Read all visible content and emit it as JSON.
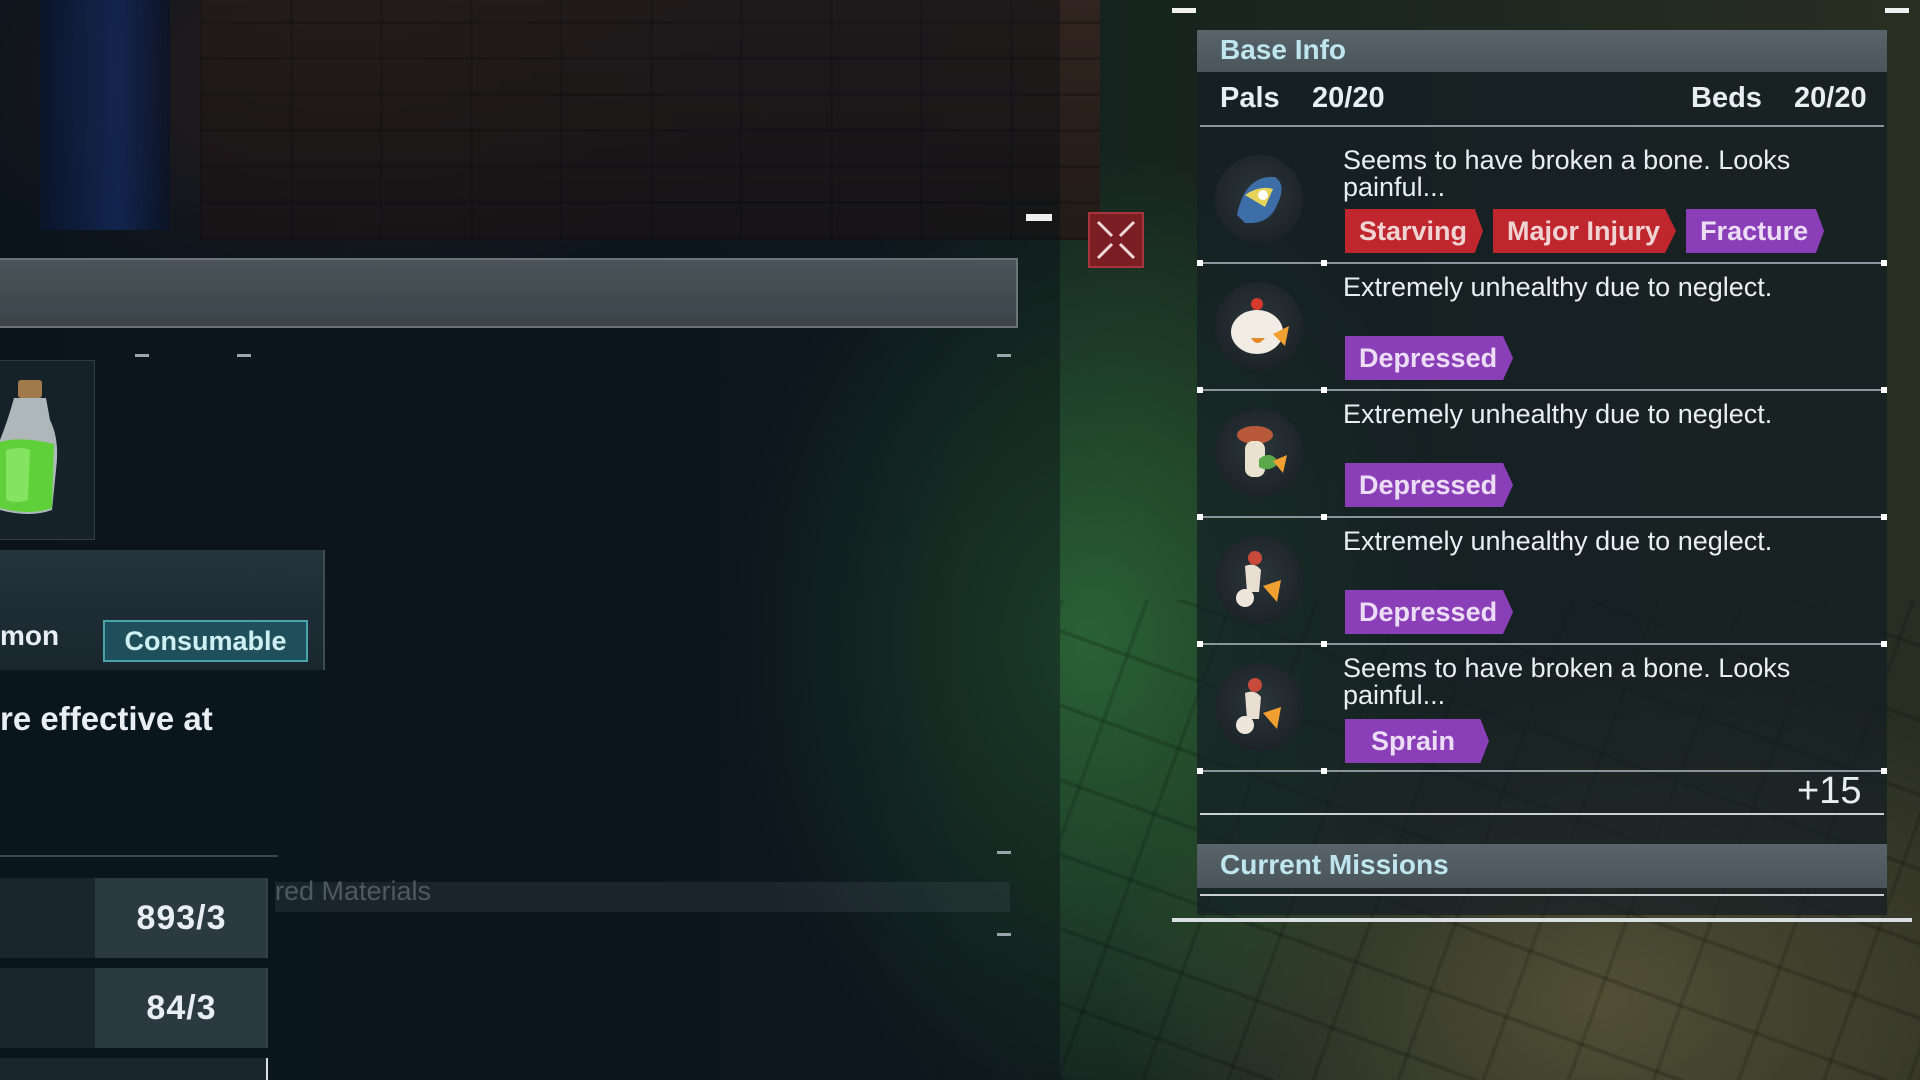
{
  "base_info": {
    "title": "Base Info",
    "pals_label": "Pals",
    "pals_count": "20/20",
    "beds_label": "Beds",
    "beds_count": "20/20",
    "pals": [
      {
        "status": "Seems to have broken a bone. Looks painful...",
        "badges": [
          {
            "label": "Starving",
            "color": "red"
          },
          {
            "label": "Major Injury",
            "color": "red"
          },
          {
            "label": "Fracture",
            "color": "purple"
          }
        ]
      },
      {
        "status": "Extremely unhealthy due to neglect.",
        "badges": [
          {
            "label": "Depressed",
            "color": "purple"
          }
        ]
      },
      {
        "status": "Extremely unhealthy due to neglect.",
        "badges": [
          {
            "label": "Depressed",
            "color": "purple"
          }
        ]
      },
      {
        "status": "Extremely unhealthy due to neglect.",
        "badges": [
          {
            "label": "Depressed",
            "color": "purple"
          }
        ]
      },
      {
        "status": "Seems to have broken a bone. Looks painful...",
        "badges": [
          {
            "label": "Sprain",
            "color": "purple"
          }
        ]
      }
    ],
    "more_count": "+15",
    "missions_title": "Current Missions"
  },
  "item": {
    "rarity_partial": "mon",
    "type_tag": "Consumable",
    "description_partial": "re effective at",
    "required_materials_partial": "red Materials",
    "materials": [
      {
        "count": "893/3"
      },
      {
        "count": "84/3"
      }
    ]
  },
  "colors": {
    "badge_red": "#c0262e",
    "badge_purple": "#8a3fb8",
    "header_text": "#bfe6ef",
    "close_button": "#7a1e24"
  },
  "icons": {
    "close": "close-x-icon",
    "potion": "medicine-potion-icon"
  }
}
